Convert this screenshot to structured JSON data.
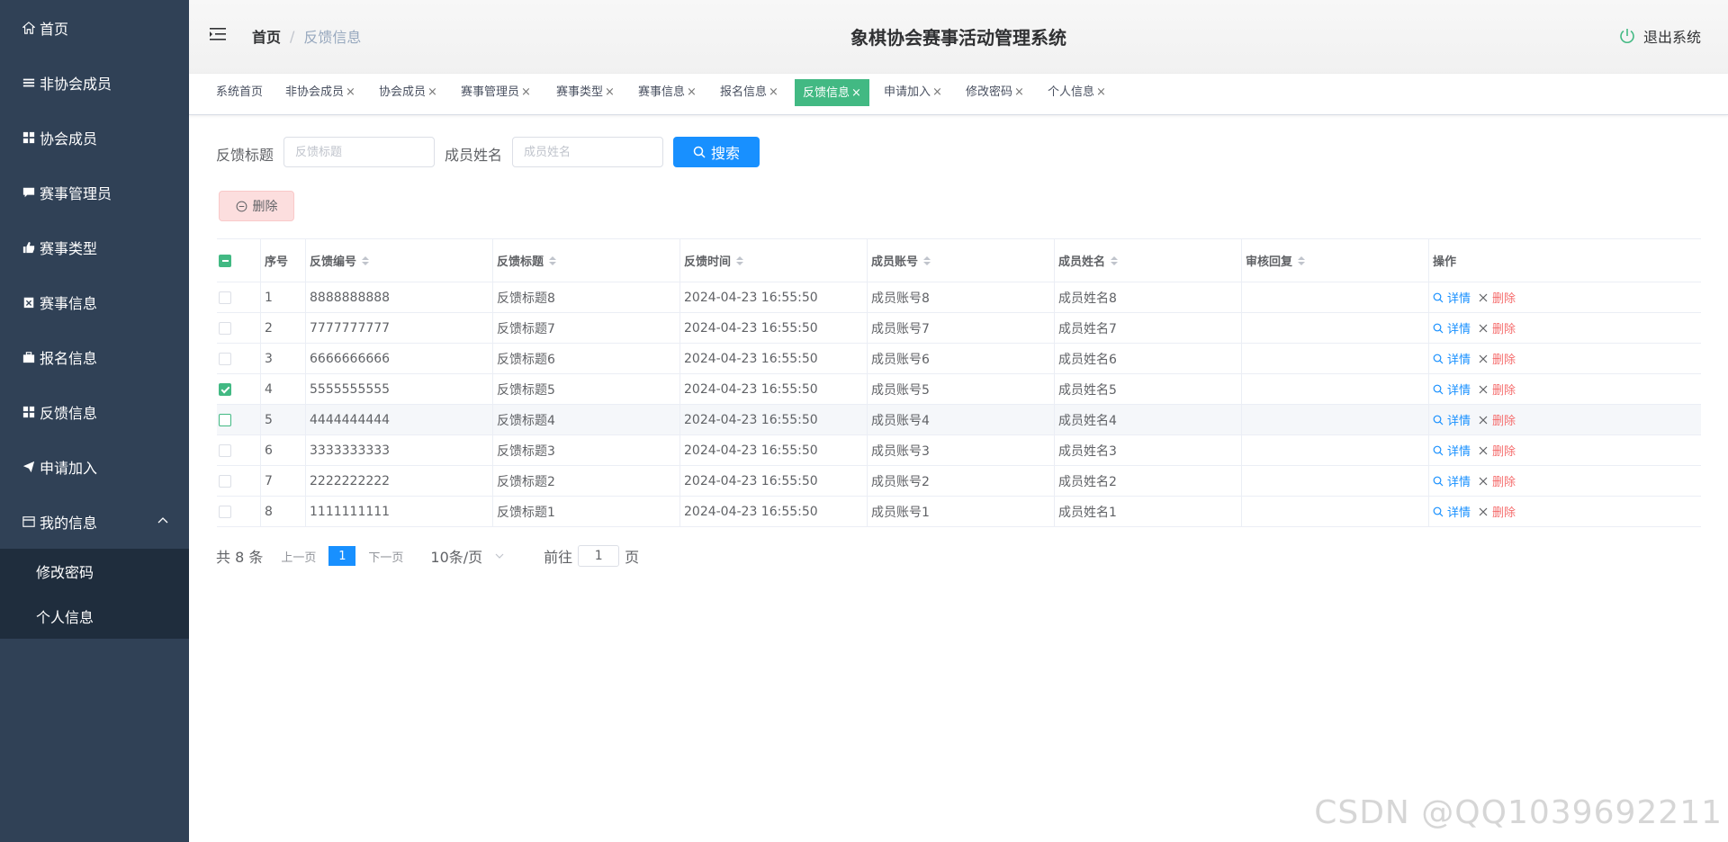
{
  "app": {
    "title": "象棋协会赛事活动管理系统",
    "logout": "退出系统"
  },
  "breadcrumb": {
    "home": "首页",
    "current": "反馈信息"
  },
  "sidebar": {
    "items": [
      {
        "label": "首页",
        "icon": "home-icon"
      },
      {
        "label": "非协会成员",
        "icon": "list-icon"
      },
      {
        "label": "协会成员",
        "icon": "grid-icon"
      },
      {
        "label": "赛事管理员",
        "icon": "comment-icon"
      },
      {
        "label": "赛事类型",
        "icon": "thumb-icon"
      },
      {
        "label": "赛事信息",
        "icon": "clipboard-icon"
      },
      {
        "label": "报名信息",
        "icon": "briefcase-icon"
      },
      {
        "label": "反馈信息",
        "icon": "grid-icon"
      },
      {
        "label": "申请加入",
        "icon": "send-icon"
      },
      {
        "label": "我的信息",
        "icon": "card-icon"
      }
    ],
    "submenu": [
      {
        "label": "修改密码"
      },
      {
        "label": "个人信息"
      }
    ]
  },
  "tags": [
    {
      "label": "系统首页"
    },
    {
      "label": "非协会成员"
    },
    {
      "label": "协会成员"
    },
    {
      "label": "赛事管理员"
    },
    {
      "label": "赛事类型"
    },
    {
      "label": "赛事信息"
    },
    {
      "label": "报名信息"
    },
    {
      "label": "反馈信息",
      "active": true
    },
    {
      "label": "申请加入"
    },
    {
      "label": "修改密码"
    },
    {
      "label": "个人信息"
    }
  ],
  "tag_close": "×",
  "search": {
    "title_label": "反馈标题",
    "title_placeholder": "反馈标题",
    "name_label": "成员姓名",
    "name_placeholder": "成员姓名",
    "button": "搜索"
  },
  "toolbar": {
    "delete": "删除"
  },
  "table": {
    "headers": [
      "序号",
      "反馈编号",
      "反馈标题",
      "反馈时间",
      "成员账号",
      "成员姓名",
      "审核回复",
      "操作"
    ],
    "rows": [
      {
        "no": "1",
        "code": "8888888888",
        "title": "反馈标题8",
        "time": "2024-04-23 16:55:50",
        "account": "成员账号8",
        "name": "成员姓名8",
        "reply": "",
        "checked": false
      },
      {
        "no": "2",
        "code": "7777777777",
        "title": "反馈标题7",
        "time": "2024-04-23 16:55:50",
        "account": "成员账号7",
        "name": "成员姓名7",
        "reply": "",
        "checked": false
      },
      {
        "no": "3",
        "code": "6666666666",
        "title": "反馈标题6",
        "time": "2024-04-23 16:55:50",
        "account": "成员账号6",
        "name": "成员姓名6",
        "reply": "",
        "checked": false
      },
      {
        "no": "4",
        "code": "5555555555",
        "title": "反馈标题5",
        "time": "2024-04-23 16:55:50",
        "account": "成员账号5",
        "name": "成员姓名5",
        "reply": "",
        "checked": true
      },
      {
        "no": "5",
        "code": "4444444444",
        "title": "反馈标题4",
        "time": "2024-04-23 16:55:50",
        "account": "成员账号4",
        "name": "成员姓名4",
        "reply": "",
        "checked": false
      },
      {
        "no": "6",
        "code": "3333333333",
        "title": "反馈标题3",
        "time": "2024-04-23 16:55:50",
        "account": "成员账号3",
        "name": "成员姓名3",
        "reply": "",
        "checked": false
      },
      {
        "no": "7",
        "code": "2222222222",
        "title": "反馈标题2",
        "time": "2024-04-23 16:55:50",
        "account": "成员账号2",
        "name": "成员姓名2",
        "reply": "",
        "checked": false
      },
      {
        "no": "8",
        "code": "1111111111",
        "title": "反馈标题1",
        "time": "2024-04-23 16:55:50",
        "account": "成员账号1",
        "name": "成员姓名1",
        "reply": "",
        "checked": false
      }
    ],
    "action_detail": "详情",
    "action_delete": "删除"
  },
  "pagination": {
    "total": "共 8 条",
    "prev": "上一页",
    "current": "1",
    "next": "下一页",
    "page_size": "10条/页",
    "goto_prefix": "前往",
    "goto_value": "1",
    "goto_suffix": "页"
  },
  "watermark": "CSDN @QQ1039692211",
  "colors": {
    "sidebar_bg": "#304156",
    "submenu_bg": "#1f2d3d",
    "accent_green": "#42b983",
    "primary_blue": "#1890ff",
    "danger": "#f56c6c"
  }
}
